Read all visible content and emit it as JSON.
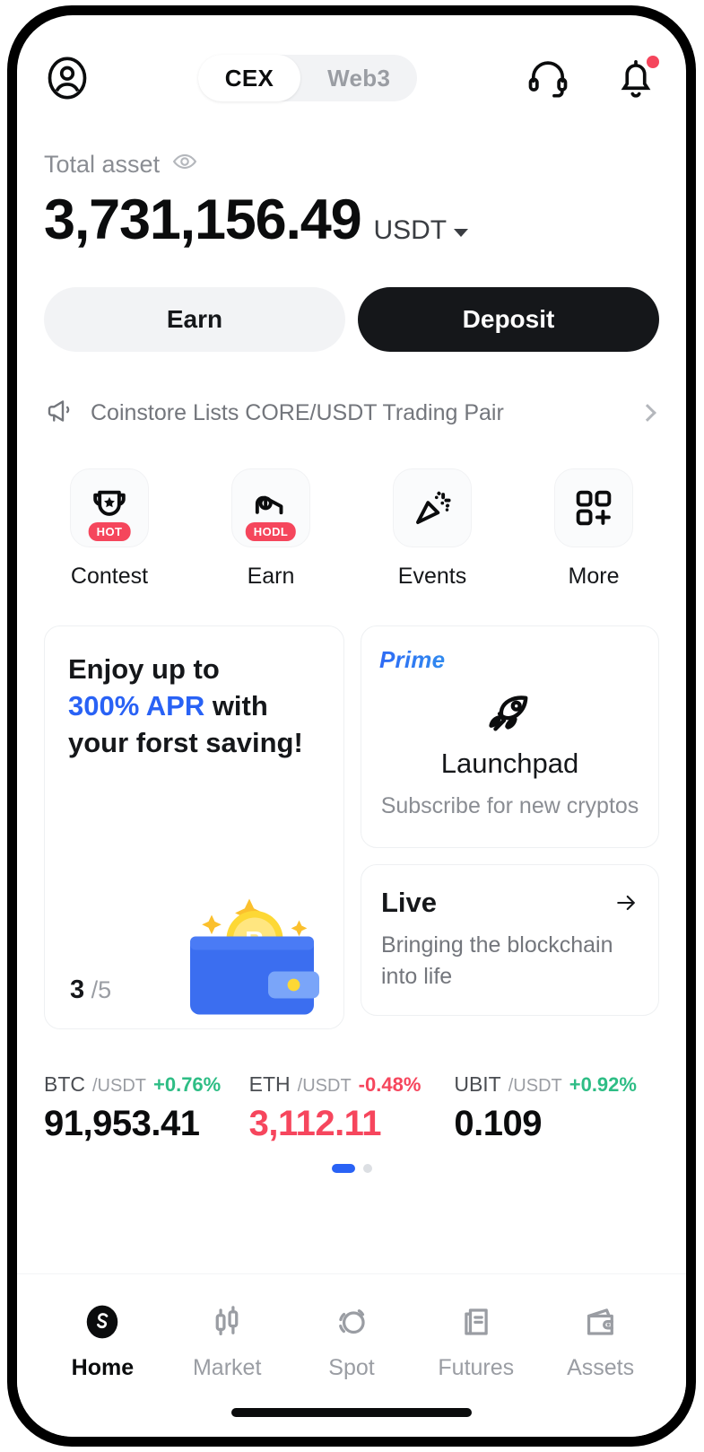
{
  "header": {
    "profile_icon": "user-circle-icon",
    "tabs": [
      {
        "label": "CEX",
        "active": true
      },
      {
        "label": "Web3",
        "active": false
      }
    ],
    "support_icon": "headset-icon",
    "notification_icon": "bell-icon",
    "has_notification": true
  },
  "balance": {
    "label": "Total asset",
    "visibility_icon": "eye-icon",
    "amount": "3,731,156.49",
    "currency": "USDT"
  },
  "actions": {
    "earn_label": "Earn",
    "deposit_label": "Deposit"
  },
  "announcement": {
    "icon": "megaphone-icon",
    "text": "Coinstore Lists CORE/USDT Trading Pair",
    "chevron": "chevron-right-icon"
  },
  "quick_actions": [
    {
      "label": "Contest",
      "icon": "trophy-icon",
      "badge": "HOT"
    },
    {
      "label": "Earn",
      "icon": "piggy-hand-icon",
      "badge": "HODL"
    },
    {
      "label": "Events",
      "icon": "confetti-icon",
      "badge": ""
    },
    {
      "label": "More",
      "icon": "grid-plus-icon",
      "badge": ""
    }
  ],
  "promo": {
    "saving_card": {
      "line1": "Enjoy up to",
      "accent": "300% APR",
      "line2_tail": " with",
      "line3": "your forst saving!",
      "page_current": "3",
      "page_total": "/5",
      "art": "wallet-bitcoin-icon"
    },
    "prime_card": {
      "tag": "Prime",
      "icon": "rocket-icon",
      "title": "Launchpad",
      "subtitle": "Subscribe for new cryptos"
    },
    "live_card": {
      "title": "Live",
      "arrow": "arrow-right-icon",
      "subtitle": "Bringing the blockchain into life"
    }
  },
  "tickers": [
    {
      "pair": "BTC",
      "quote": "/USDT",
      "change": "+0.76%",
      "direction": "up",
      "price": "91,953.41"
    },
    {
      "pair": "ETH",
      "quote": "/USDT",
      "change": "-0.48%",
      "direction": "down",
      "price": "3,112.11"
    },
    {
      "pair": "UBIT",
      "quote": "/USDT",
      "change": "+0.92%",
      "direction": "up",
      "price": "0.109"
    }
  ],
  "carousel": {
    "total": 2,
    "active_index": 0
  },
  "bottom_nav": [
    {
      "label": "Home",
      "icon": "home-logo-icon",
      "active": true
    },
    {
      "label": "Market",
      "icon": "candlestick-icon",
      "active": false
    },
    {
      "label": "Spot",
      "icon": "spot-trade-icon",
      "active": false
    },
    {
      "label": "Futures",
      "icon": "futures-doc-icon",
      "active": false
    },
    {
      "label": "Assets",
      "icon": "wallet-icon",
      "active": false
    }
  ],
  "colors": {
    "accent_blue": "#2962f5",
    "up_green": "#2ebd85",
    "down_red": "#f6465d",
    "badge_red": "#f5465c",
    "dark": "#15171a"
  }
}
